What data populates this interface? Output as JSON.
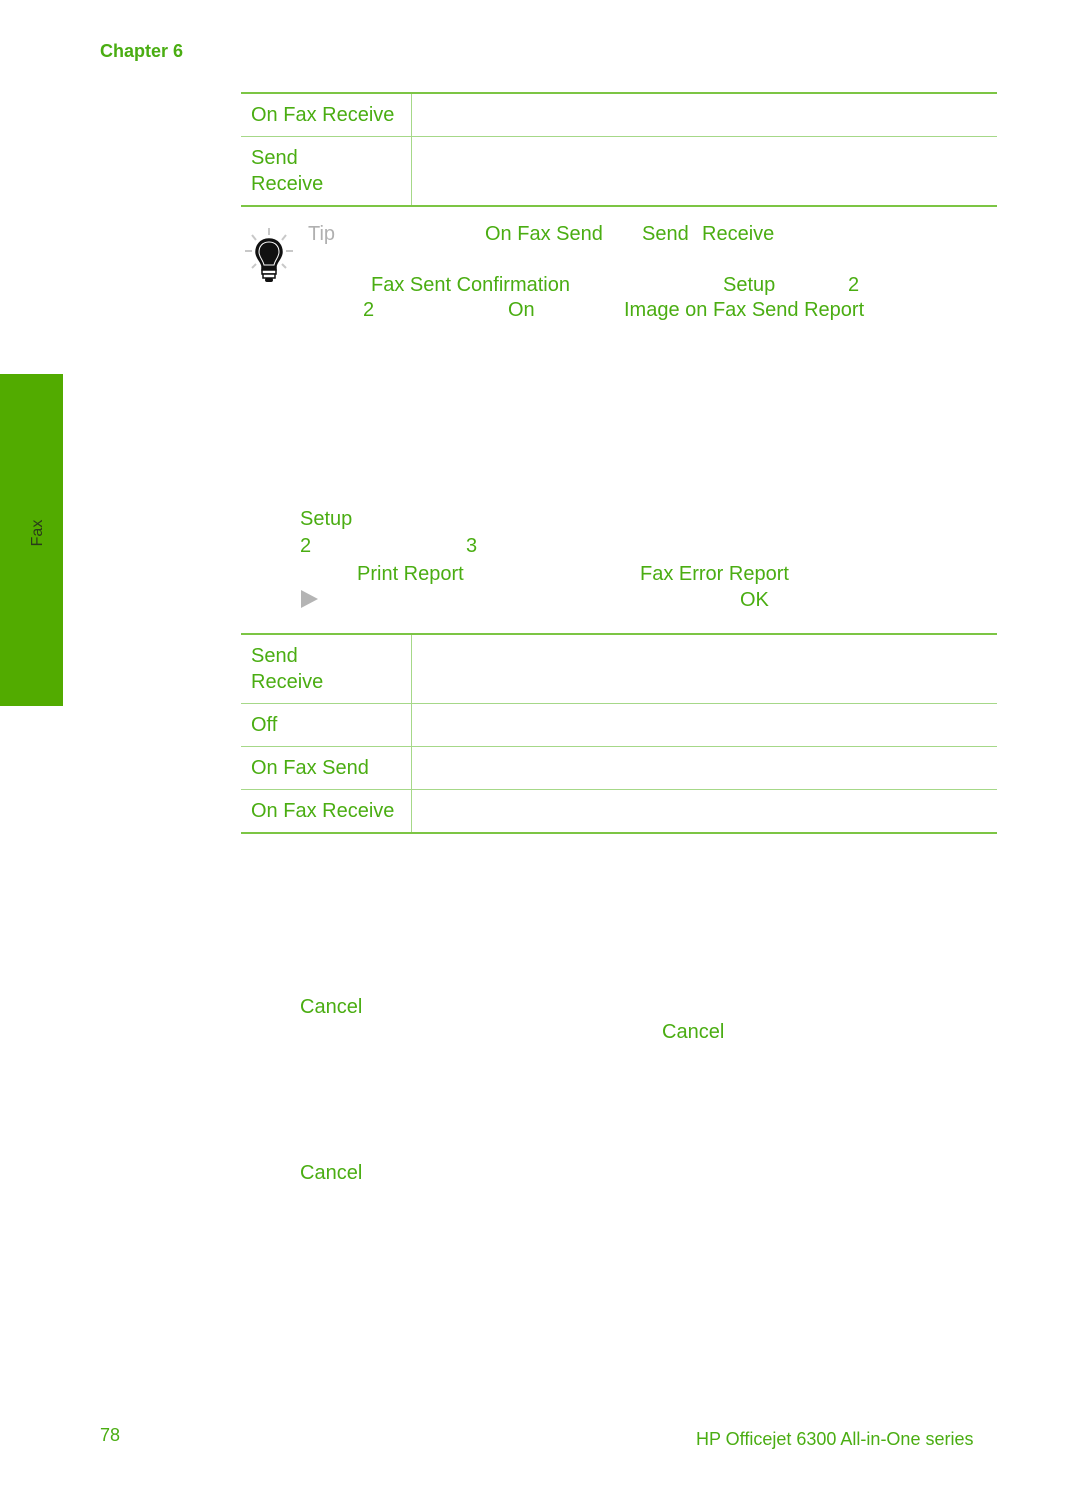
{
  "header": {
    "chapter": "Chapter 6"
  },
  "table1": {
    "rows": [
      {
        "label_lines": [
          "On Fax Receive"
        ]
      },
      {
        "label_lines": [
          "Send",
          "Receive"
        ]
      }
    ]
  },
  "tip": {
    "label": "Tip",
    "icon": "lightbulb-icon",
    "fragments": {
      "on_fax_send": "On Fax Send",
      "send": "Send",
      "receive": "Receive",
      "fax_sent_confirmation": "Fax Sent Confirmation",
      "setup": "Setup",
      "num_2a": "2",
      "num_2b": "2",
      "on": "On",
      "image_report": "Image on Fax Send Report"
    }
  },
  "sidebar": {
    "tab_label": "Fax",
    "color": "#52ab00"
  },
  "steps": {
    "setup": "Setup",
    "num_2": "2",
    "num_3": "3",
    "print_report": "Print Report",
    "fax_error_report": "Fax Error Report",
    "arrow_icon": "right-arrow-icon",
    "ok": "OK"
  },
  "table2": {
    "rows": [
      {
        "label_lines": [
          "Send",
          "Receive"
        ]
      },
      {
        "label_lines": [
          "Off"
        ]
      },
      {
        "label_lines": [
          "On Fax Send"
        ]
      },
      {
        "label_lines": [
          "On Fax Receive"
        ]
      }
    ]
  },
  "cancel_section": {
    "cancel_1": "Cancel",
    "cancel_2": "Cancel",
    "cancel_3": "Cancel"
  },
  "footer": {
    "page_number": "78",
    "product": "HP Officejet 6300 All-in-One series"
  },
  "colors": {
    "accent": "#4aad12",
    "rule": "#7cc544",
    "tip_gray": "#b0b0b0"
  }
}
